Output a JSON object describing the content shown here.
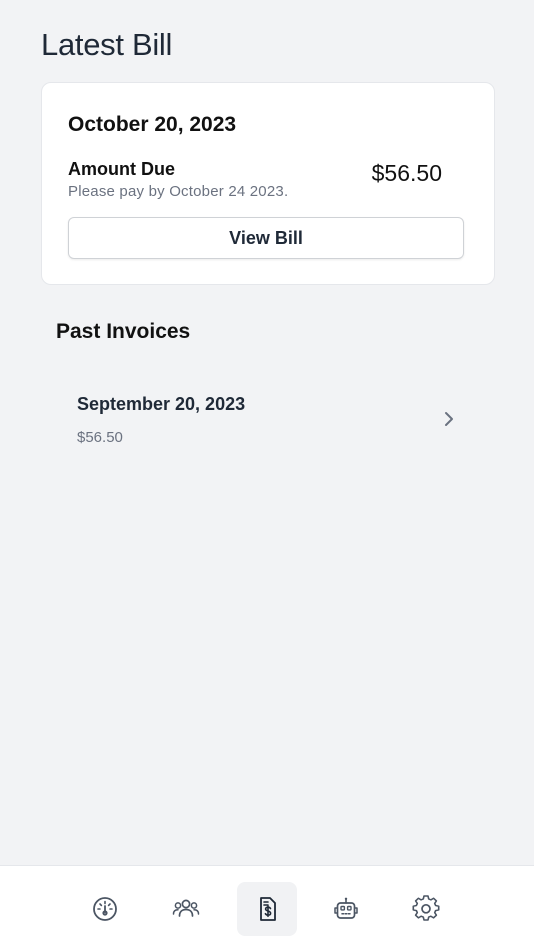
{
  "header": {
    "title": "Latest Bill"
  },
  "latest_bill": {
    "date": "October 20, 2023",
    "amount_label": "Amount Due",
    "due_note": "Please pay by October 24 2023.",
    "amount": "$56.50",
    "view_button_label": "View Bill"
  },
  "past_invoices": {
    "title": "Past Invoices",
    "items": [
      {
        "date": "September 20, 2023",
        "amount": "$56.50"
      }
    ]
  },
  "bottom_nav": {
    "active": "billing",
    "items": [
      {
        "icon": "dashboard-gauge-icon"
      },
      {
        "icon": "users-icon"
      },
      {
        "icon": "invoice-dollar-icon"
      },
      {
        "icon": "robot-icon"
      },
      {
        "icon": "gear-icon"
      }
    ]
  },
  "colors": {
    "background": "#f2f3f5",
    "card": "#ffffff",
    "muted_text": "#6b7280",
    "icon": "#4b5563"
  }
}
